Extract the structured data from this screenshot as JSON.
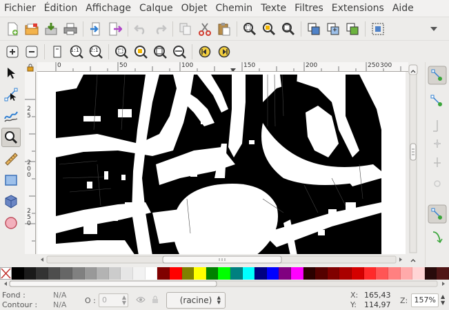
{
  "menubar": {
    "items": [
      "Fichier",
      "Édition",
      "Affichage",
      "Calque",
      "Objet",
      "Chemin",
      "Texte",
      "Filtres",
      "Extensions",
      "Aide"
    ]
  },
  "commands_toolbar": {
    "icons": [
      "new-document-icon",
      "open-icon",
      "save-icon",
      "print-icon",
      "import-icon",
      "export-icon",
      "undo-icon",
      "redo-icon",
      "copy-icon",
      "cut-icon",
      "paste-icon",
      "zoom-selection-icon",
      "zoom-drawing-icon",
      "zoom-page-icon",
      "duplicate-icon",
      "clone-icon",
      "unlink-clone-icon",
      "group-icon",
      "toolbar-overflow-icon"
    ]
  },
  "zoom_toolbar": {
    "icons": [
      "zoom-in-icon",
      "zoom-out-icon",
      "zoom-page-icon",
      "zoom-1-1-icon",
      "zoom-1-2-icon",
      "zoom-selection-icon",
      "zoom-drawing-icon",
      "zoom-page-full-icon",
      "zoom-page-width-icon",
      "zoom-previous-icon",
      "zoom-next-icon"
    ],
    "zoom_11_label": "1:1",
    "zoom_21_label": "2:1"
  },
  "toolbox": {
    "tools": [
      "selector-tool",
      "node-tool",
      "tweak-tool",
      "zoom-tool",
      "measure-tool",
      "rectangle-tool",
      "3d-box-tool",
      "ellipse-tool"
    ],
    "active": "zoom-tool"
  },
  "rulers": {
    "horizontal_labels": [
      "0",
      "50",
      "100",
      "150",
      "200",
      "250",
      "300"
    ],
    "vertical_labels": [
      [
        "2",
        "5"
      ],
      [
        "2",
        "0",
        "0"
      ],
      [
        "2",
        "5",
        "0"
      ]
    ]
  },
  "palette": {
    "colors": [
      "#000000",
      "#1a1a1a",
      "#333333",
      "#4d4d4d",
      "#666666",
      "#808080",
      "#999999",
      "#b3b3b3",
      "#cccccc",
      "#e6e6e6",
      "#f2f2f2",
      "#ffffff",
      "#800000",
      "#ff0000",
      "#808000",
      "#ffff00",
      "#008000",
      "#00ff00",
      "#008080",
      "#00ffff",
      "#000080",
      "#0000ff",
      "#800080",
      "#ff00ff",
      "#2b0000",
      "#550000",
      "#800000",
      "#aa0000",
      "#d40000",
      "#ff2a2a",
      "#ff5555",
      "#ff8080",
      "#ffaaaa",
      "#ffd5d5",
      "#280b0b",
      "#501616"
    ]
  },
  "statusbar": {
    "fill_label": "Fond :",
    "stroke_label": "Contour :",
    "fill_value": "N/A",
    "stroke_value": "N/A",
    "opacity_label": "O :",
    "opacity_value": "0",
    "layer_value": "(racine)",
    "x_label": "X:",
    "x_value": "165,43",
    "y_label": "Y:",
    "y_value": "114,97",
    "zoom_label": "Z:",
    "zoom_value": "157%"
  }
}
